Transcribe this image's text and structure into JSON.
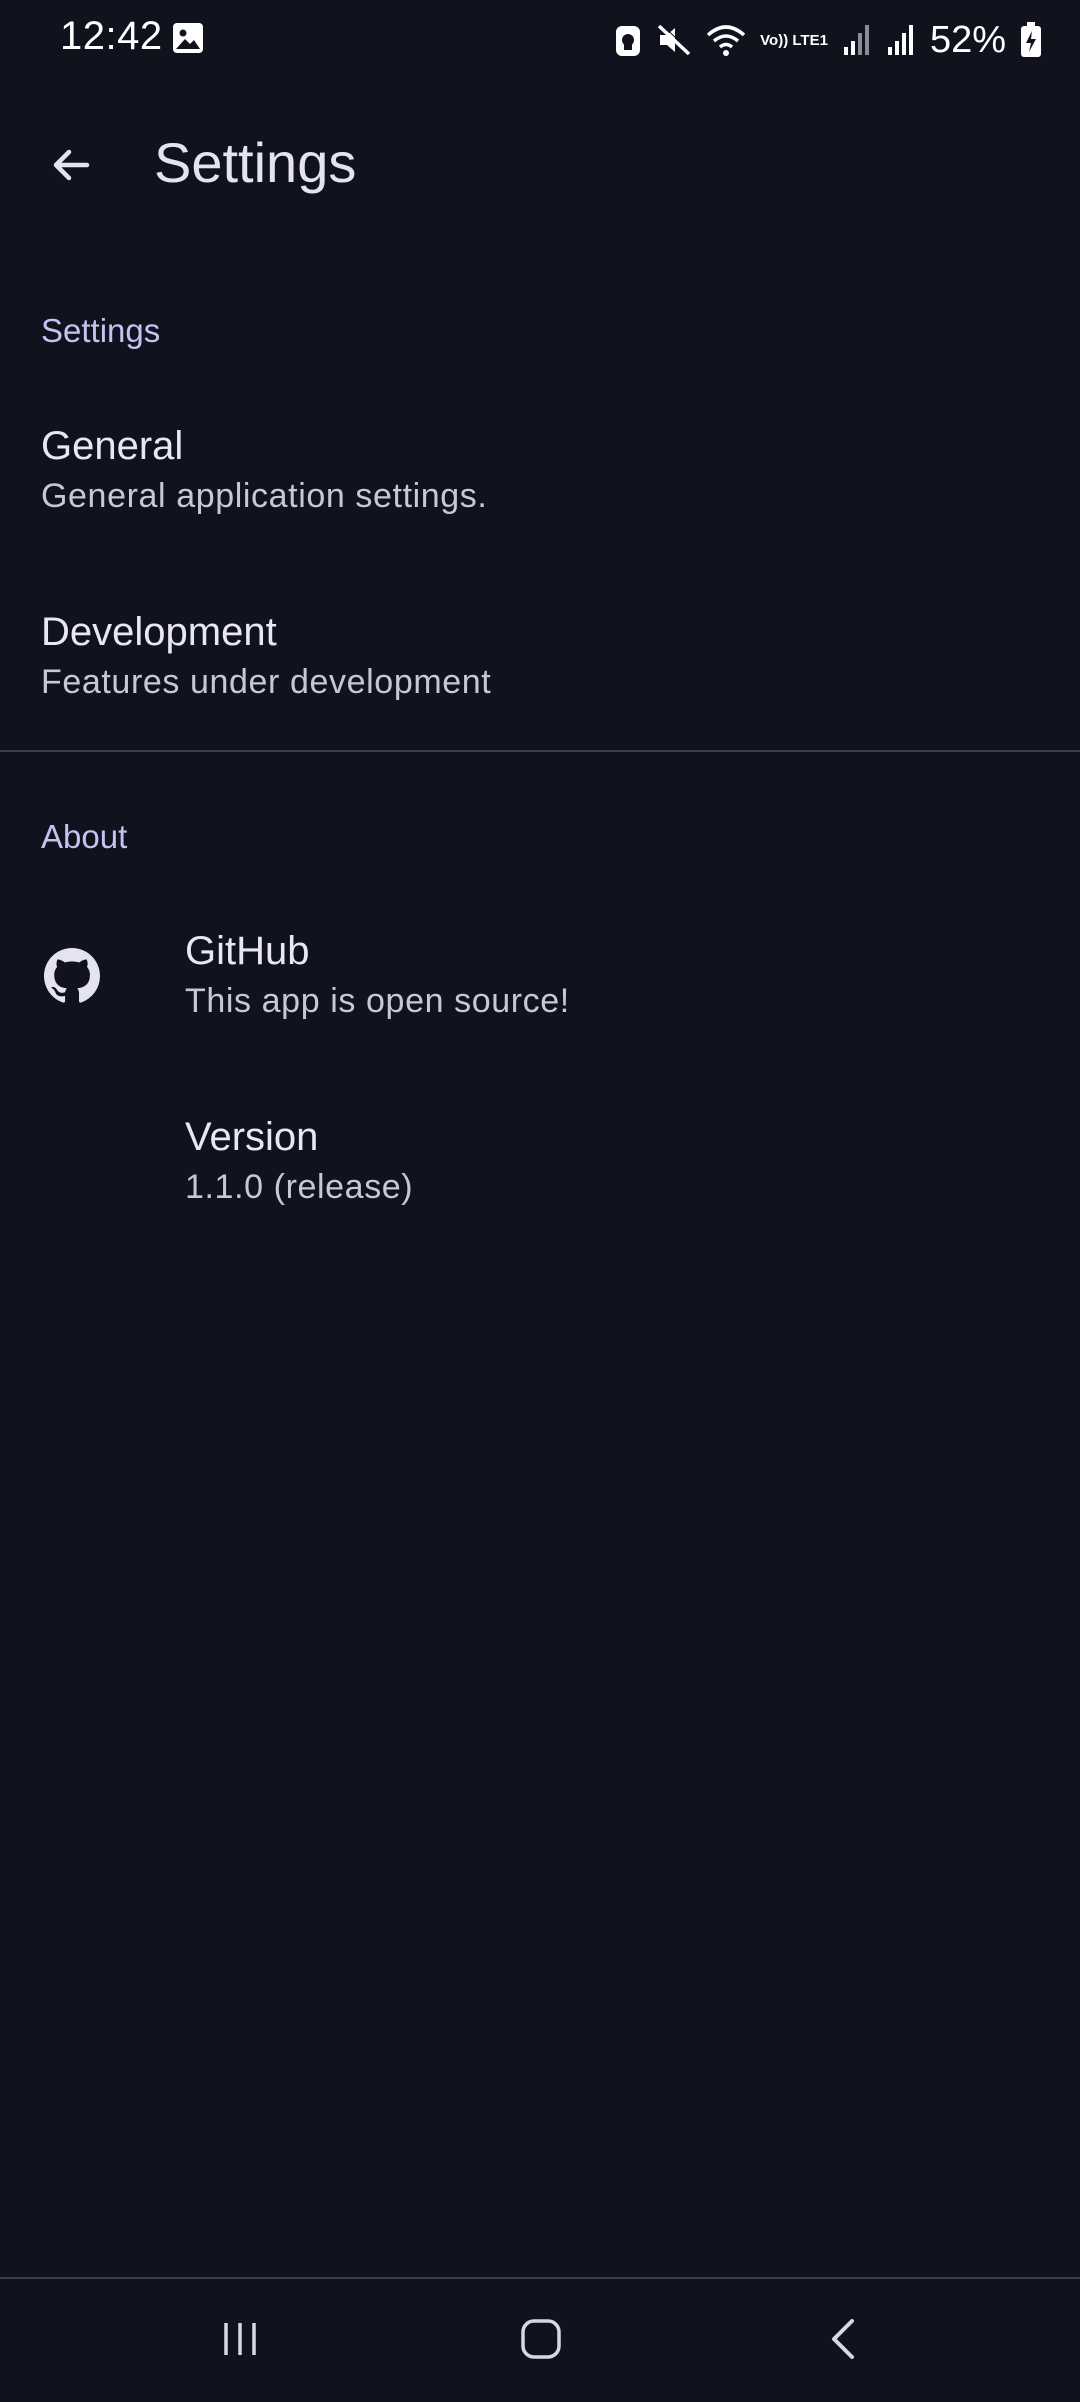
{
  "status_bar": {
    "time": "12:42",
    "battery_percent": "52%",
    "volte_label": "Vo)) LTE1",
    "icons": [
      "gallery-icon",
      "bixby-lock-icon",
      "mute-icon",
      "wifi-icon",
      "volte-icon",
      "signal-icon",
      "signal-icon",
      "battery-charging-icon"
    ]
  },
  "app_bar": {
    "title": "Settings",
    "back_icon": "arrow-back-icon"
  },
  "sections": [
    {
      "header": "Settings",
      "items": [
        {
          "title": "General",
          "summary": "General application settings."
        },
        {
          "title": "Development",
          "summary": "Features under development"
        }
      ]
    },
    {
      "header": "About",
      "items": [
        {
          "title": "GitHub",
          "summary": "This app is open source!",
          "icon": "github-icon"
        },
        {
          "title": "Version",
          "summary": "1.1.0 (release)"
        }
      ]
    }
  ],
  "nav_bar": {
    "buttons": [
      "recents-icon",
      "home-icon",
      "back-icon"
    ]
  },
  "colors": {
    "background": "#10131e",
    "section_header": "#c5c2f0",
    "title": "#e8e7f2",
    "summary": "#c9c7d5"
  }
}
